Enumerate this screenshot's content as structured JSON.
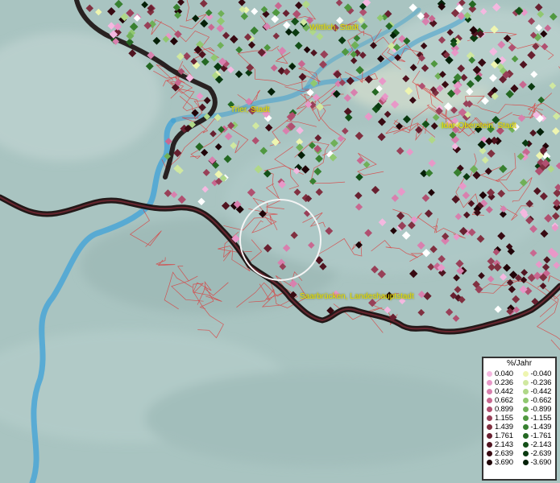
{
  "map": {
    "background_color": "#a9c4c1",
    "river_color": "#4aa6d6",
    "border_color": "#1a0f0f",
    "district_line_color": "#e03030",
    "cities": [
      {
        "name": "Wittlich, Stadt"
      },
      {
        "name": "Trier, Stadt"
      },
      {
        "name": "Idar-Oberstein, Stadt"
      },
      {
        "name": "Saarbrücken, Landeshauptstadt"
      }
    ]
  },
  "legend": {
    "title": "%/Jahr",
    "positive": [
      {
        "label": "0.040",
        "color": "#f4b8e0"
      },
      {
        "label": "0.236",
        "color": "#e898c8"
      },
      {
        "label": "0.442",
        "color": "#d880ae"
      },
      {
        "label": "0.662",
        "color": "#c86890"
      },
      {
        "label": "0.899",
        "color": "#b05070"
      },
      {
        "label": "1.155",
        "color": "#984058"
      },
      {
        "label": "1.439",
        "color": "#803040"
      },
      {
        "label": "1.761",
        "color": "#682030"
      },
      {
        "label": "2.143",
        "color": "#501420"
      },
      {
        "label": "2.639",
        "color": "#380a12"
      },
      {
        "label": "3.690",
        "color": "#200408"
      }
    ],
    "negative": [
      {
        "label": "-0.040",
        "color": "#eef5b0"
      },
      {
        "label": "-0.236",
        "color": "#d0e8a0"
      },
      {
        "label": "-0.442",
        "color": "#b0d888"
      },
      {
        "label": "-0.662",
        "color": "#90c870"
      },
      {
        "label": "-0.899",
        "color": "#70b058"
      },
      {
        "label": "-1.155",
        "color": "#509840"
      },
      {
        "label": "-1.439",
        "color": "#388030"
      },
      {
        "label": "-1.761",
        "color": "#246822"
      },
      {
        "label": "-2.143",
        "color": "#145018"
      },
      {
        "label": "-2.639",
        "color": "#0a3a10"
      },
      {
        "label": "-3.690",
        "color": "#042008"
      }
    ]
  }
}
